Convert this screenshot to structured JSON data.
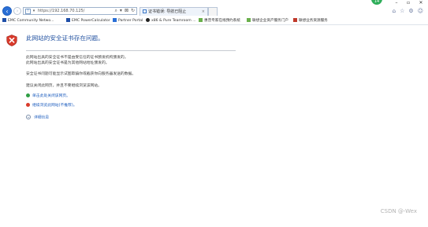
{
  "browser": {
    "url": "https://192.168.70.125/",
    "tab_title": "证书错误: 导航已阻止",
    "notification_badge": "14"
  },
  "favorites": [
    {
      "label": "EMC Community Netwo...",
      "icon_color": "#1f4fa8"
    },
    {
      "label": "EMC PowerCalculator",
      "icon_color": "#1f4fa8"
    },
    {
      "label": "Partner Portal",
      "icon_color": "#2a6fd6"
    },
    {
      "label": "x86 & Pure Teamroom ...",
      "icon_color": "#222222"
    },
    {
      "label": "惠普专家在线预约系统",
      "icon_color": "#6ab04c"
    },
    {
      "label": "联想企业资产服务门户",
      "icon_color": "#6ab04c"
    },
    {
      "label": "联想业务资源服务",
      "icon_color": "#c0392b"
    }
  ],
  "error_page": {
    "heading": "此网站的安全证书存在问题。",
    "para1_line1": "此网站出具的安全证书不是由受信任的证书颁发机构颁发的。",
    "para1_line2": "此网站出具的安全证书是为其他网站地址颁发的。",
    "para2": "安全证书问题可能显示试图欺骗你或截获你向服务器发送的数据。",
    "para3": "建议关闭此网页，并且不要继续浏览该网站。",
    "action_close": "单击此处关闭该网页。",
    "action_continue": "继续浏览此网站(不推荐)。",
    "details": "详细信息"
  },
  "watermark": "CSDN @-Wex",
  "colors": {
    "heading": "#1f4f9f",
    "link": "#1f5fbf",
    "shield_red": "#d93a2b",
    "ok_green": "#2f9e44"
  }
}
